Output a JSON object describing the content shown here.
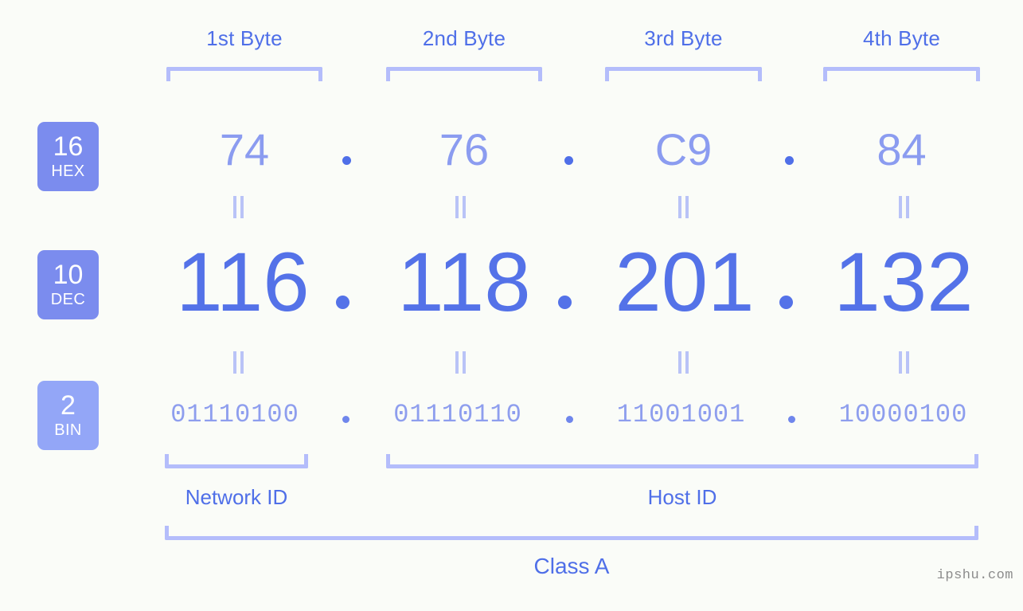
{
  "background": "#fafcf8",
  "colors": {
    "accent_strong": "#4f6fe8",
    "accent_dec": "#5472e8",
    "accent_hex": "#8b9cf0",
    "accent_bin": "#8e9eee",
    "bracket": "#b4bdfb",
    "badge_solid": "#7b8cee",
    "badge_light": "#93a6f7",
    "eq_mark": "#b9c3f7",
    "watermark": "#8c8c8c"
  },
  "byte_headers": [
    {
      "label": "1st Byte"
    },
    {
      "label": "2nd Byte"
    },
    {
      "label": "3rd Byte"
    },
    {
      "label": "4th Byte"
    }
  ],
  "bases": [
    {
      "number": "16",
      "name": "HEX"
    },
    {
      "number": "10",
      "name": "DEC"
    },
    {
      "number": "2",
      "name": "BIN"
    }
  ],
  "rows": {
    "hex": {
      "base_number": "16",
      "base_name": "HEX",
      "values": [
        "74",
        "76",
        "C9",
        "84"
      ],
      "separator": "."
    },
    "dec": {
      "base_number": "10",
      "base_name": "DEC",
      "values": [
        "116",
        "118",
        "201",
        "132"
      ],
      "separator": "."
    },
    "bin": {
      "base_number": "2",
      "base_name": "BIN",
      "values": [
        "01110100",
        "01110110",
        "11001001",
        "10000100"
      ],
      "separator": "."
    }
  },
  "equality_symbol": "||",
  "segments": {
    "network_id": {
      "label": "Network ID",
      "bytes": 1
    },
    "host_id": {
      "label": "Host ID",
      "bytes": 3
    }
  },
  "class": {
    "label": "Class A"
  },
  "watermark": {
    "text": "ipshu.com"
  }
}
